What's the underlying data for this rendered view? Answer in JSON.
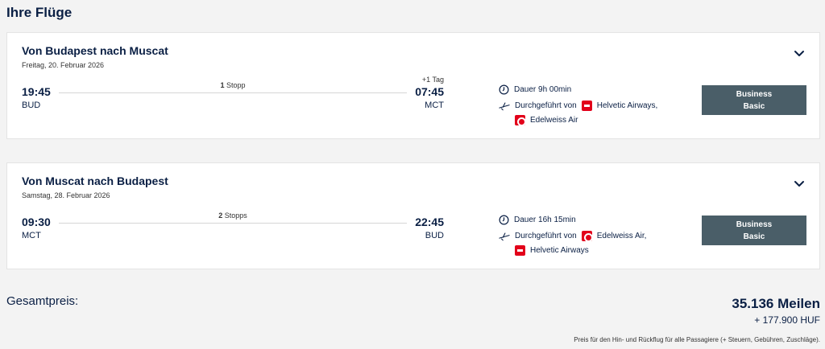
{
  "page": {
    "title": "Ihre Flüge"
  },
  "flights": [
    {
      "route": "Von Budapest nach Muscat",
      "date": "Freitag, 20. Februar 2026",
      "dep_time": "19:45",
      "dep_code": "BUD",
      "arr_time": "07:45",
      "arr_code": "MCT",
      "plus_day": "+1 Tag",
      "stops_count": "1",
      "stops_label": "Stopp",
      "duration": "Dauer 9h 00min",
      "operated_by": "Durchgeführt von",
      "airline1": "Helvetic Airways,",
      "airline2": "Edelweiss Air",
      "fare_line1": "Business",
      "fare_line2": "Basic"
    },
    {
      "route": "Von Muscat nach Budapest",
      "date": "Samstag, 28. Februar 2026",
      "dep_time": "09:30",
      "dep_code": "MCT",
      "arr_time": "22:45",
      "arr_code": "BUD",
      "plus_day": "",
      "stops_count": "2",
      "stops_label": "Stopps",
      "duration": "Dauer 16h 15min",
      "operated_by": "Durchgeführt von",
      "airline1": "Edelweiss Air,",
      "airline2": "Helvetic Airways",
      "fare_line1": "Business",
      "fare_line2": "Basic"
    }
  ],
  "total": {
    "label": "Gesamtpreis:",
    "miles": "35.136 Meilen",
    "huf": "+ 177.900 HUF",
    "footnote": "Preis für den Hin- und Rückflug für alle Passagiere (+ Steuern, Gebühren, Zuschläge)."
  },
  "icons": {
    "expand": "chevron-down-icon",
    "duration": "clock-icon",
    "operator": "plane-icon",
    "helvetic": "helvetic-logo-icon",
    "edelweiss": "edelweiss-logo-icon"
  },
  "colors": {
    "navy": "#0a1f44",
    "fare_button": "#4a5e68",
    "airline_red": "#e2001a"
  }
}
